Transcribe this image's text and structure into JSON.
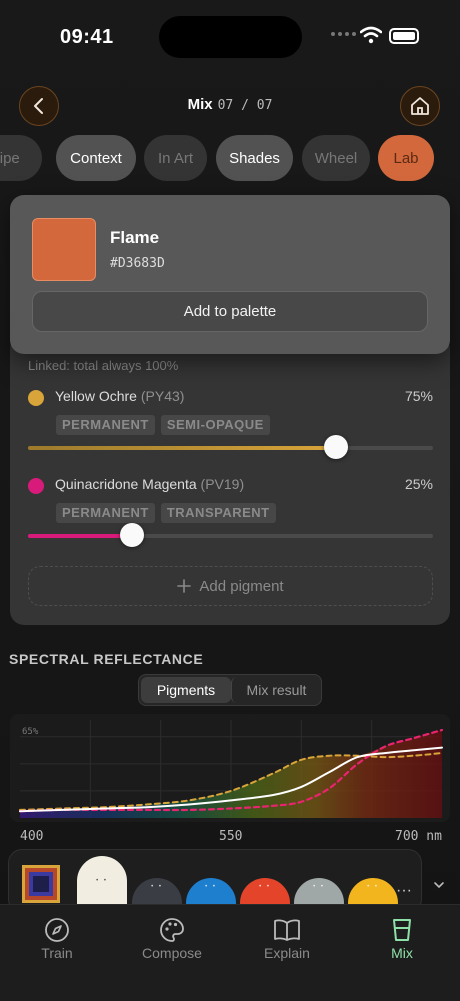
{
  "status": {
    "time": "09:41"
  },
  "header": {
    "title": "Mix",
    "step": "07 / 07"
  },
  "tabs": [
    {
      "label": "cipe"
    },
    {
      "label": "Context"
    },
    {
      "label": "In Art"
    },
    {
      "label": "Shades"
    },
    {
      "label": "Wheel"
    },
    {
      "label": "Lab"
    }
  ],
  "colors": {
    "flame": "#D3683D",
    "accent_green": "#8EE0A8"
  },
  "popup": {
    "name": "Flame",
    "hex": "#D3683D",
    "add_label": "Add to palette"
  },
  "mixer": {
    "note": "Linked: total always 100%",
    "pigments": [
      {
        "name": "Yellow Ochre",
        "code": "(PY43)",
        "percent": "75%",
        "value": 0.75,
        "color": "#D9A53A",
        "tags": [
          "PERMANENT",
          "SEMI-OPAQUE"
        ]
      },
      {
        "name": "Quinacridone Magenta",
        "code": "(PV19)",
        "percent": "25%",
        "value": 0.25,
        "color": "#D81B7A",
        "tags": [
          "PERMANENT",
          "TRANSPARENT"
        ]
      }
    ],
    "add_label": "Add pigment"
  },
  "spectral": {
    "title": "SPECTRAL REFLECTANCE",
    "toggle": {
      "pigments": "Pigments",
      "mix": "Mix result"
    },
    "y_label": "65%",
    "x_ticks": [
      "400",
      "550",
      "700 nm"
    ]
  },
  "chart_data": {
    "type": "line",
    "xlabel": "",
    "ylabel": "",
    "xlim": [
      400,
      700
    ],
    "ylim": [
      0,
      65
    ],
    "x": [
      400,
      430,
      460,
      490,
      520,
      550,
      580,
      600,
      620,
      640,
      660,
      680,
      700
    ],
    "series": [
      {
        "values": [
          6,
          7,
          8,
          10,
          13,
          20,
          33,
          43,
          46,
          46,
          45,
          46,
          48
        ]
      },
      {
        "values": [
          5,
          6,
          6,
          6,
          6,
          7,
          9,
          12,
          22,
          40,
          53,
          59,
          65
        ]
      },
      {
        "values": [
          5,
          6,
          7,
          8,
          10,
          13,
          17,
          23,
          34,
          45,
          48,
          50,
          52
        ]
      }
    ]
  },
  "swatch_strip": {
    "colors": [
      "#F1EDE0",
      "#3A3D44",
      "#1E7FCE",
      "#E4442A",
      "#9FA8A6",
      "#F2B51E"
    ],
    "more": "···"
  },
  "tabbar": [
    {
      "label": "Train",
      "icon": "compass-icon"
    },
    {
      "label": "Compose",
      "icon": "palette-icon"
    },
    {
      "label": "Explain",
      "icon": "book-icon"
    },
    {
      "label": "Mix",
      "icon": "cup-icon"
    }
  ]
}
